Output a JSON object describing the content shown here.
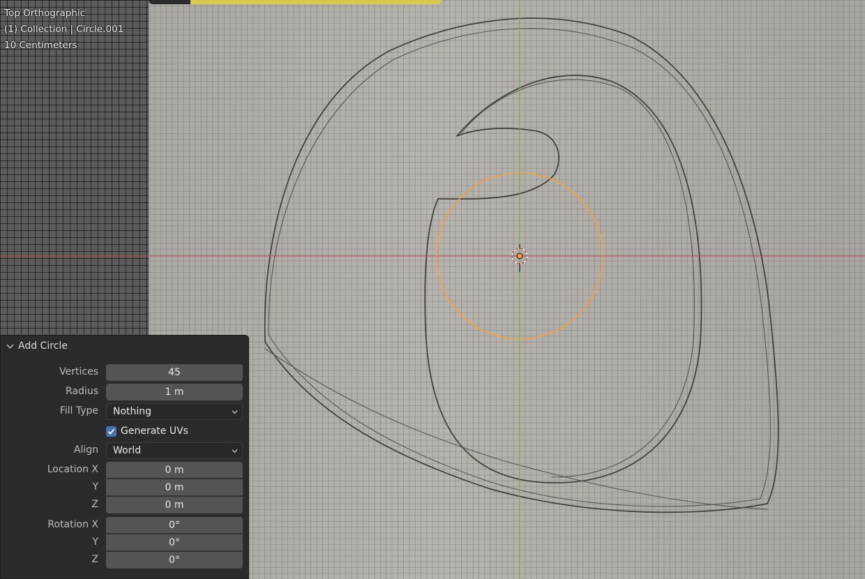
{
  "viewport": {
    "view_name": "Top Orthographic",
    "collection_info": "(1) Collection | Circle.001",
    "scale_info": "10 Centimeters"
  },
  "operator_panel": {
    "title": "Add Circle",
    "vertices": {
      "label": "Vertices",
      "value": "45"
    },
    "radius": {
      "label": "Radius",
      "value": "1 m"
    },
    "fill_type": {
      "label": "Fill Type",
      "value": "Nothing"
    },
    "generate_uvs": {
      "label": "Generate UVs",
      "checked": true
    },
    "align": {
      "label": "Align",
      "value": "World"
    },
    "location": {
      "label_x": "Location X",
      "label_y": "Y",
      "label_z": "Z",
      "x": "0 m",
      "y": "0 m",
      "z": "0 m"
    },
    "rotation": {
      "label_x": "Rotation X",
      "label_y": "Y",
      "label_z": "Z",
      "x": "0°",
      "y": "0°",
      "z": "0°"
    }
  },
  "colors": {
    "selection_orange": "#f5a03a",
    "x_axis": "#c8454f",
    "y_axis": "#7fb23a",
    "checkbox_blue": "#4772b3"
  }
}
